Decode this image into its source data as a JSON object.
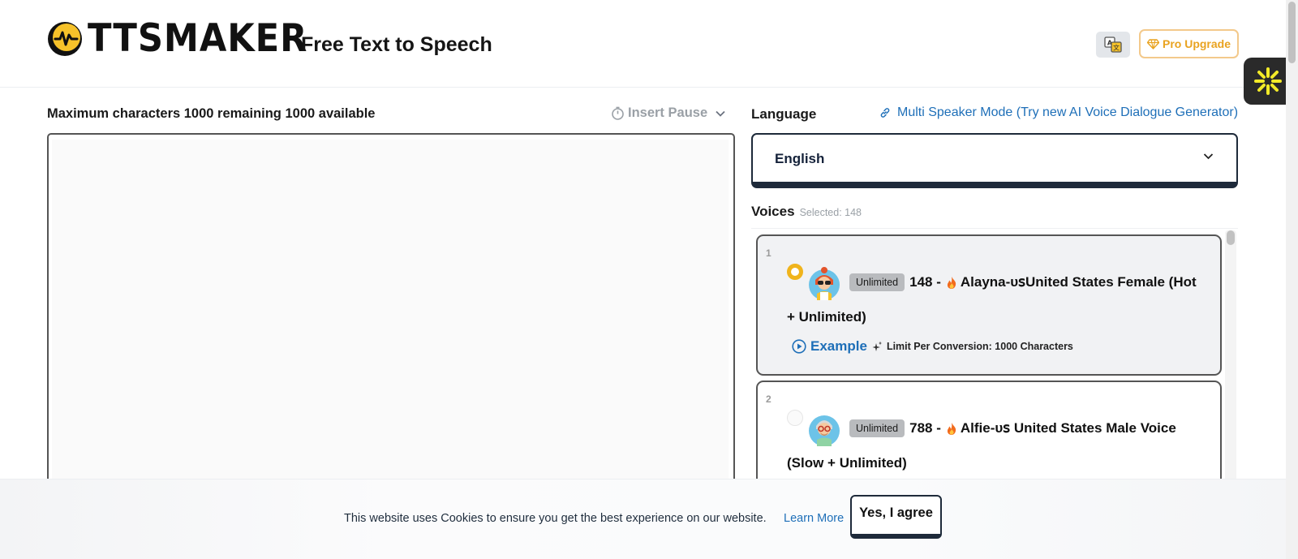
{
  "header": {
    "brand": "TTSMAKER",
    "subtitle": "Free Text to Speech",
    "translate_icon": "translate-icon",
    "pro_upgrade_label": "Pro Upgrade",
    "pro_icon": "diamond-icon"
  },
  "editor": {
    "char_info": "Maximum characters 1000 remaining 1000 available",
    "insert_pause_label": "Insert Pause",
    "text_value": ""
  },
  "language": {
    "label": "Language",
    "multi_speaker_link": "Multi Speaker Mode (Try new AI Voice Dialogue Generator)",
    "selected": "English"
  },
  "voices": {
    "label": "Voices",
    "selected_count": "Selected: 148",
    "items": [
      {
        "index": "1",
        "badge": "Unlimited",
        "title_prefix": "148 -",
        "title_main": "Alayna-ᴜꜱUnited States Female (Hot",
        "title_cont": "+ Unlimited)",
        "example_label": "Example",
        "limit_text": "Limit Per Conversion: 1000 Characters",
        "selected": true
      },
      {
        "index": "2",
        "badge": "Unlimited",
        "title_prefix": "788 -",
        "title_main": "Alfie-ᴜꜱ United States Male Voice",
        "title_cont": "(Slow + Unlimited)",
        "selected": false
      }
    ]
  },
  "cookie": {
    "message": "This website uses Cookies to ensure you get the best experience on our website.",
    "learn_more": "Learn More",
    "agree_label": "Yes, I agree"
  },
  "colors": {
    "accent_blue": "#1e6fb8",
    "pro_gold": "#e9a320",
    "radio_selected": "#f0b41c",
    "dark_border": "#1e2a3a"
  }
}
